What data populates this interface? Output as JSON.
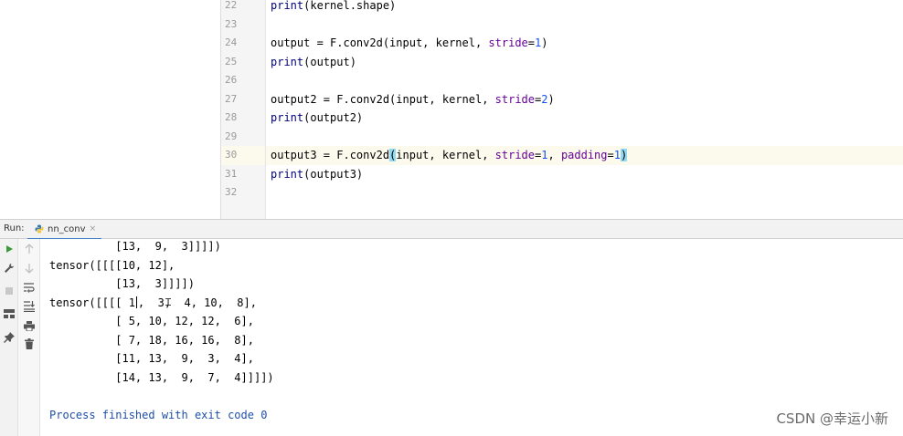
{
  "editor": {
    "line_numbers": [
      "22",
      "23",
      "24",
      "25",
      "26",
      "27",
      "28",
      "29",
      "30",
      "31",
      "32"
    ],
    "lines": {
      "l22": {
        "fn": "print",
        "rest": "(kernel.shape)"
      },
      "l24": {
        "lhs": "output = F.conv2d(input, kernel, ",
        "p1": "stride",
        "eq": "=",
        "v1": "1",
        "end": ")"
      },
      "l25": {
        "fn": "print",
        "rest": "(output)"
      },
      "l27": {
        "lhs": "output2 = F.conv2d(input, kernel, ",
        "p1": "stride",
        "eq": "=",
        "v1": "2",
        "end": ")"
      },
      "l28": {
        "fn": "print",
        "rest": "(output2)"
      },
      "l30": {
        "lhs": "output3 = F.conv2d",
        "open": "(",
        "mid": "input, kernel, ",
        "p1": "stride",
        "eq1": "=",
        "v1": "1",
        "sep": ", ",
        "p2": "padding",
        "eq2": "=",
        "v2": "1",
        "close": ")"
      },
      "l31": {
        "fn": "print",
        "rest": "(output3)"
      }
    }
  },
  "run": {
    "label": "Run:",
    "tab_name": "nn_conv",
    "close": "×"
  },
  "toolbar": {
    "run_icon": "play-icon",
    "wrench_icon": "wrench-icon",
    "stop_icon": "stop-icon",
    "layout_icon": "layout-icon",
    "pin_icon": "pin-icon",
    "up_icon": "arrow-up-icon",
    "down_icon": "arrow-down-icon",
    "wrap_icon": "soft-wrap-icon",
    "scroll_icon": "scroll-to-end-icon",
    "print_icon": "print-icon",
    "trash_icon": "trash-icon"
  },
  "console": {
    "lines": [
      "          [13,  9,  3]]]])",
      "tensor([[[[10, 12],",
      "          [13,  3]]]])",
      "tensor([[[[ 1,  3,  4, 10,  8],",
      "          [ 5, 10, 12, 12,  6],",
      "          [ 7, 18, 16, 16,  8],",
      "          [11, 13,  9,  3,  4],",
      "          [14, 13,  9,  7,  4]]]])",
      "",
      "Process finished with exit code 0"
    ],
    "tensor3_first_a": "tensor([[[[ 1",
    "tensor3_first_b": ",  3,  4, 10,  8],"
  },
  "watermark": "CSDN @幸运小新",
  "colors": {
    "keyword_fn": "#000080",
    "param": "#660099",
    "number": "#1750eb",
    "brace_highlight": "#93d9f2",
    "current_line": "#fcfaed",
    "exit_text": "#1f4fa8",
    "tab_underline": "#4083c9"
  }
}
